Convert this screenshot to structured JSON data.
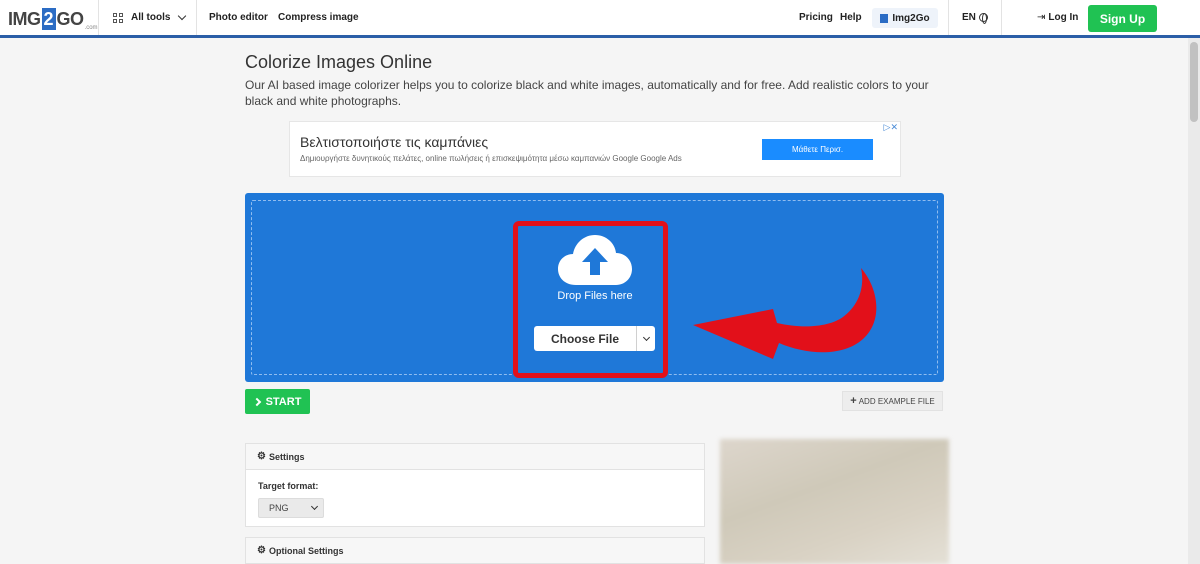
{
  "header": {
    "logo": {
      "part1": "IMG",
      "part2": "2",
      "part3": "GO",
      "tail": ".com"
    },
    "all_tools": "All tools",
    "photo_editor": "Photo editor",
    "compress_image": "Compress image",
    "pricing": "Pricing",
    "help": "Help",
    "brand_pill": "Img2Go",
    "language": "EN",
    "login": "Log In",
    "signup": "Sign Up"
  },
  "main": {
    "title": "Colorize Images Online",
    "description": "Our AI based image colorizer helps you to colorize black and white images, automatically and for free. Add realistic colors to your black and white photographs."
  },
  "ad": {
    "title": "Βελτιστοποιήστε τις καμπάνιες",
    "subtitle": "Δημιουργήστε δυνητικούς πελάτες, online πωλήσεις ή επισκεψιμότητα μέσω καμπανιών Google Google Ads",
    "button": "Μάθετε Περισ."
  },
  "upload": {
    "drop_text": "Drop Files here",
    "choose_file": "Choose File",
    "start": "START",
    "add_example": "ADD EXAMPLE FILE"
  },
  "settings": {
    "heading": "Settings",
    "target_format_label": "Target format:",
    "target_format_value": "PNG",
    "optional_heading": "Optional Settings"
  },
  "colors": {
    "accent_blue": "#1f78d8",
    "green": "#20c253",
    "highlight_red": "#e2101a"
  }
}
